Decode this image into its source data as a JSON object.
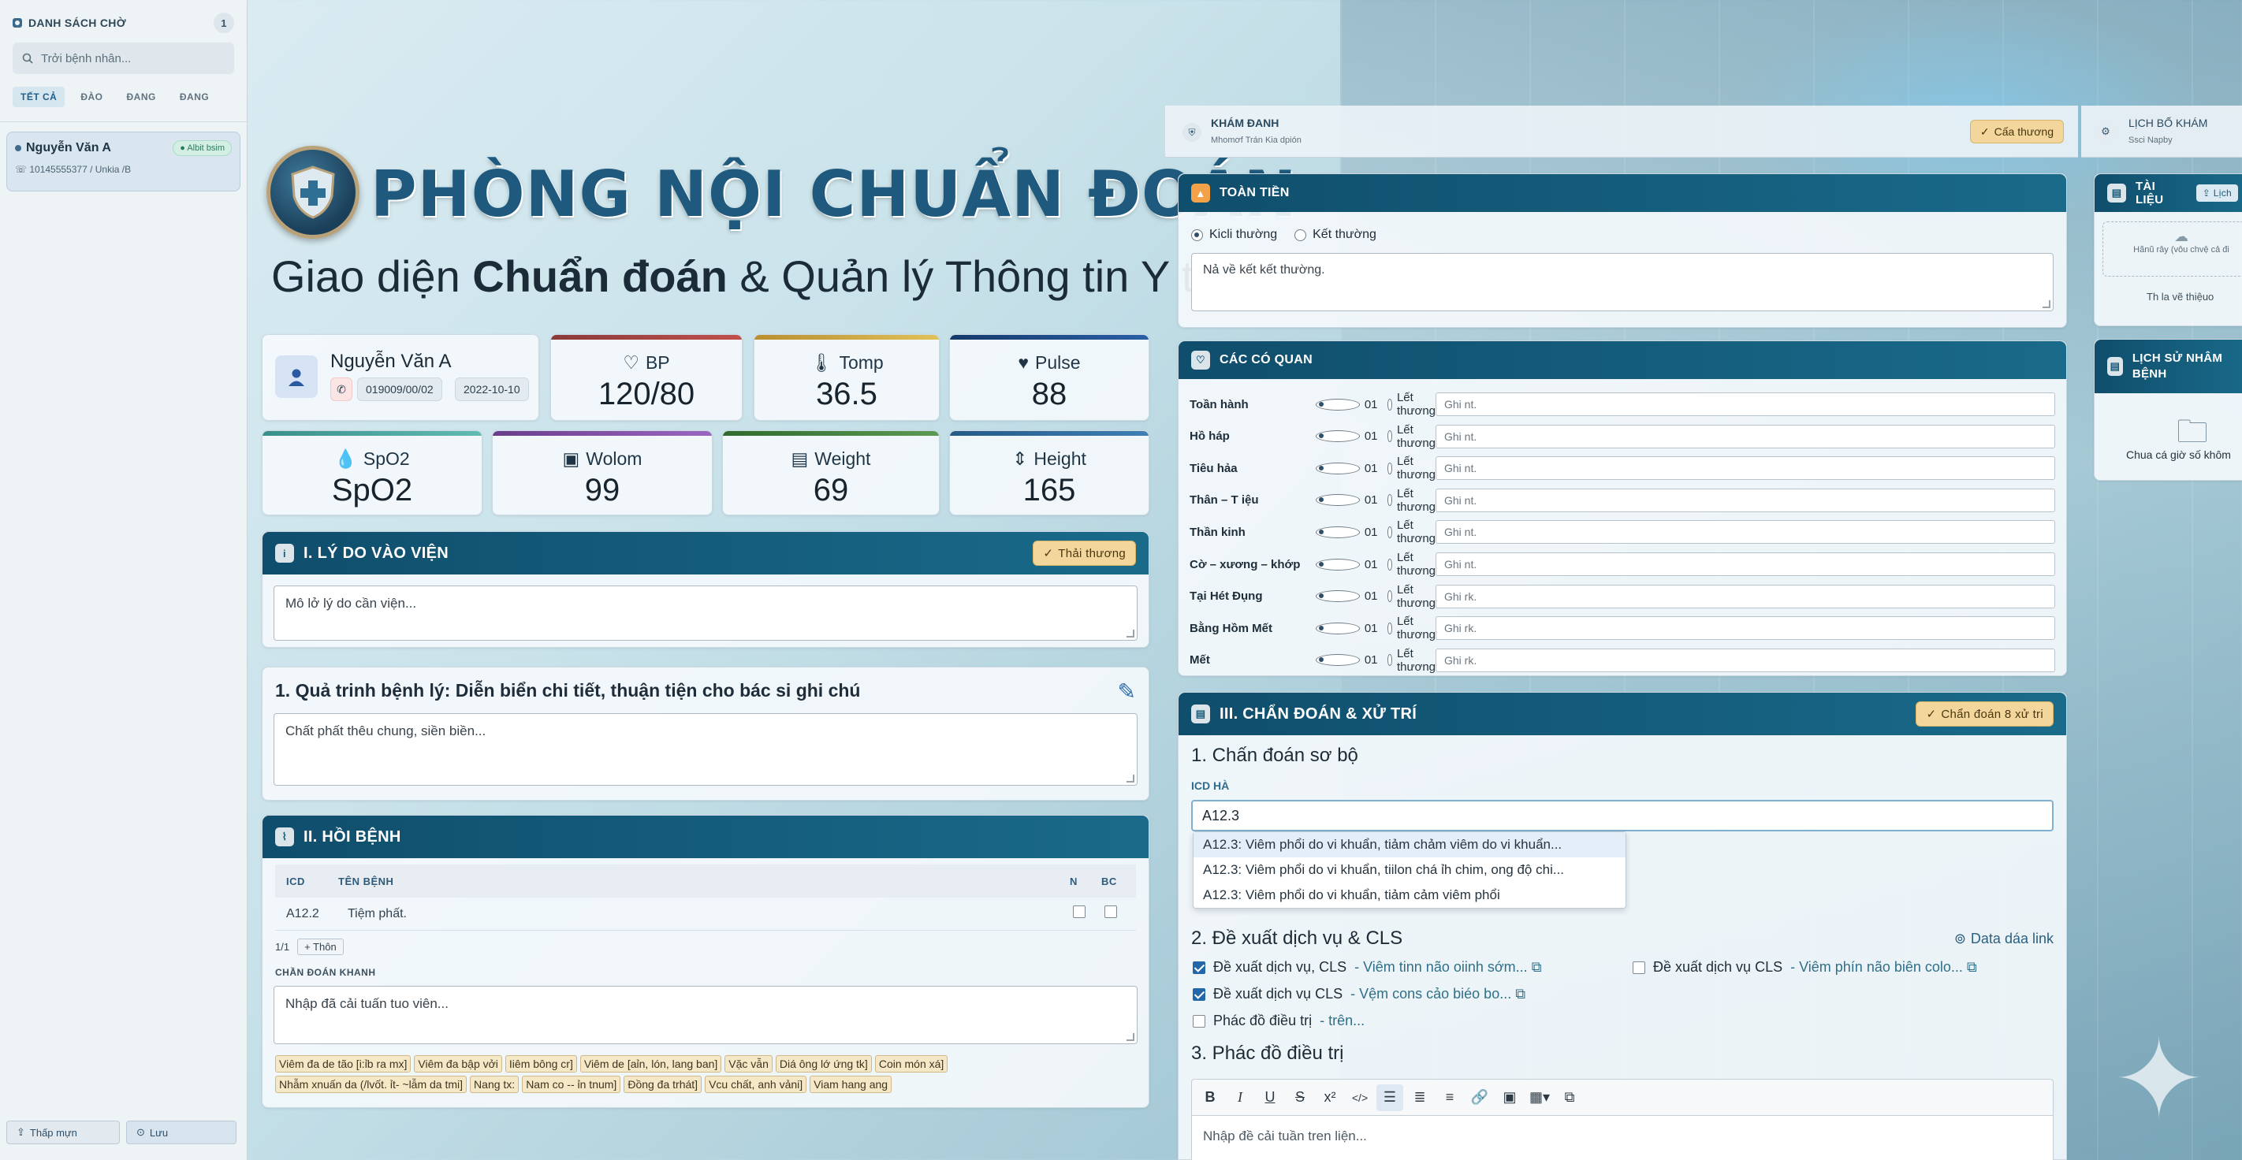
{
  "sidebar": {
    "title": "DANH SÁCH CHỜ",
    "count": "1",
    "search_placeholder": "Trởi bệnh nhân...",
    "tabs": [
      "TẾT CẢ",
      "ĐÀO",
      "ĐANG",
      "ĐANG"
    ],
    "patient": {
      "name": "Nguyễn Văn A",
      "badge": "Albit bsim",
      "phone": "10145555377 / Unkia /B"
    },
    "btn_left": "Thấp mựn",
    "btn_right": "Lưu"
  },
  "hero": {
    "title": "PHÒNG NỘI CHUẨN ĐOÁN",
    "subtitle_pre": "Giao diện ",
    "subtitle_bold": "Chuẩn đoán",
    "subtitle_post": " & Quản lý Thông tin Y tế"
  },
  "patient": {
    "name": "Nguyễn Văn A",
    "id": "019009/00/02",
    "date": "2022-10-10"
  },
  "vitals": [
    {
      "label": "BP",
      "value": "120/80",
      "color": "#c0504d"
    },
    {
      "label": "Tomp",
      "value": "36.5",
      "color": "#d8b14a"
    },
    {
      "label": "Pulse",
      "value": "88",
      "color": "#1f4e8c"
    },
    {
      "label": "SpO2",
      "value": "SpO2",
      "color": "#4aa3a0"
    },
    {
      "label": "Wolom",
      "value": "99",
      "color": "#7d4ea1"
    },
    {
      "label": "Weight",
      "value": "69",
      "color": "#3e7a3a"
    },
    {
      "label": "Height",
      "value": "165",
      "color": "#2e6e9e"
    }
  ],
  "section1": {
    "title": "I. LÝ DO VÀO VIỆN",
    "tag": "Thải thương",
    "placeholder": "Mô lở lý do cần viện..."
  },
  "history": {
    "title": "1. Quả trinh bệnh lý: Diễn biển chi tiết, thuận tiện cho bác si ghi chú",
    "placeholder": "Chất phất thêu chung, siền biền..."
  },
  "section2": {
    "title": "II. HỒI BỆNH",
    "headers": [
      "ICD",
      "TÊN BỆNH",
      "N",
      "BC"
    ],
    "rows": [
      {
        "icd": "A12.2",
        "name": "Tiệm phất."
      }
    ],
    "pager": "1/1",
    "add": "Thôn",
    "label": "CHẦN ĐOÁN KHANH",
    "placeholder": "Nhập đã cải tuấn tuo viên...",
    "keywords": [
      "Viêm đa de tão [i:ỉb ra mx]",
      "Viêm đa bập vởi",
      "Iiêm bông cr]",
      "Viêm de [aỉn, lón, lang ban]",
      "Vặc vẫn",
      "Diá ông lớ ứng tk]",
      "Coin món xá]",
      "Nhẫm xnuấn da (/lvốt. ỉt- ~lẫm da tmi]",
      "Nang tx:",
      "Nam co -- ỉn tnum]",
      "Đồng đa trhát]",
      "Vcu chất, anh vảni]",
      "Viam hang ang"
    ]
  },
  "kham": {
    "title": "KHÁM ĐANH",
    "sub": "Mhomơf Trán Kia dpión",
    "tag": "Cấa thương"
  },
  "toan": {
    "title": "TOÀN TIỀN",
    "opt1": "Kicli thường",
    "opt2": "Kết thường",
    "placeholder": "Nả về kết kết thường."
  },
  "organs": {
    "title": "CÁC CÓ QUAN",
    "opt_a": "01",
    "opt_b": "Lết thương",
    "rows": [
      {
        "name": "Toần hành",
        "note": "Ghi nt."
      },
      {
        "name": "Hồ háp",
        "note": "Ghi nt."
      },
      {
        "name": "Tiêu hảa",
        "note": "Ghi nt."
      },
      {
        "name": "Thân – T iệu",
        "note": "Ghi nt."
      },
      {
        "name": "Thần kinh",
        "note": "Ghi nt."
      },
      {
        "name": "Cờ – xương – khớp",
        "note": "Ghi nt."
      },
      {
        "name": "Tại Hét Đụng",
        "note": "Ghi rk."
      },
      {
        "name": "Bằng Hồm Mết",
        "note": "Ghi rk."
      },
      {
        "name": "Mết",
        "note": "Ghi rk."
      }
    ]
  },
  "diag": {
    "title": "III. CHẨN ĐOÁN & XỬ TRÍ",
    "tag": "Chẩn đoán 8 xử tri",
    "sub1": "1. Chấn đoán sơ bộ",
    "icd_label": "ICD HÀ",
    "icd_value": "A12.3",
    "options": [
      "A12.3: Viêm phổi do vi khuẩn, tiảm chảm viêm do vi khuẩn...",
      "A12.3: Viêm phổi do vi khuẩn, tiilon chá ỉh chim, ong độ chi...",
      "A12.3: Viêm phổi do vi khuẩn, tiảm cảm viêm phổi"
    ],
    "sub2": "2. Đề xuất dịch vụ & CLS",
    "data_link": "Data dáa link",
    "services": [
      {
        "label": "Đề xuất dịch vụ, CLS",
        "link": "Viêm tinn não oiinh sớm...",
        "checked": true
      },
      {
        "label": "Đề xuất dịch vụ CLS",
        "link": "Viêm phín não biên colo...",
        "checked": false
      },
      {
        "label": "Đề xuất dịch vụ CLS",
        "link": "Vệm cons cảo biéo bo...",
        "checked": true
      },
      {
        "label": "Phác đồ điều trị",
        "link": "trên...",
        "checked": false
      }
    ],
    "sub3": "3. Phác đồ điều trị",
    "editor_placeholder": "Nhập đề cải tuần tren liện..."
  },
  "right": {
    "lich_title": "LỊCH BỐ KHÁM",
    "lich_sub": "Ssci Napby",
    "tailieu_title": "TÀI LIỆU",
    "tailieu_btn": "Lịch",
    "upload_text": "Hãnũ rây (vôu chvệ cả đi",
    "upload_link": "Th la vẽ thiệuo",
    "lichsu_title": "LỊCH SỬ NHÂM BỆNH",
    "lichsu_empty": "Chua cá giờ số khôm"
  }
}
